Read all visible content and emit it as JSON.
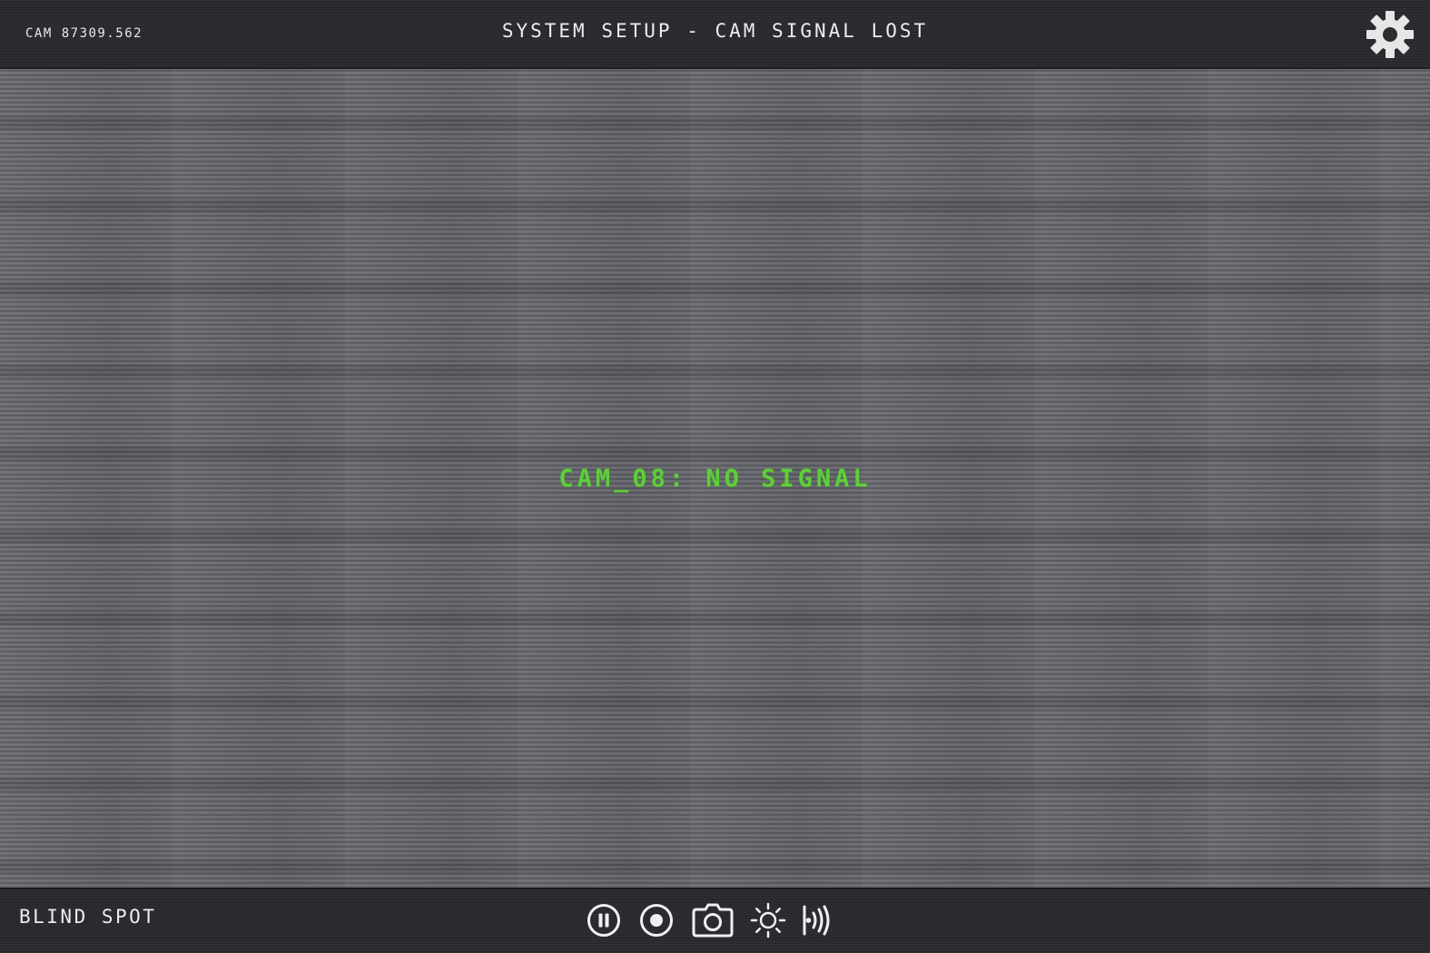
{
  "header": {
    "cam_id": "CAM 87309.562",
    "title": "SYSTEM SETUP - CAM SIGNAL LOST",
    "settings_icon": "gear-icon"
  },
  "viewport": {
    "message": "CAM_08: NO SIGNAL",
    "message_color": "#5fce3a"
  },
  "footer": {
    "label": "BLIND SPOT",
    "controls": [
      {
        "name": "pause",
        "icon": "pause-icon"
      },
      {
        "name": "record",
        "icon": "record-icon"
      },
      {
        "name": "snapshot",
        "icon": "camera-icon"
      },
      {
        "name": "brightness",
        "icon": "brightness-icon"
      },
      {
        "name": "audio",
        "icon": "audio-broadcast-icon"
      }
    ]
  }
}
